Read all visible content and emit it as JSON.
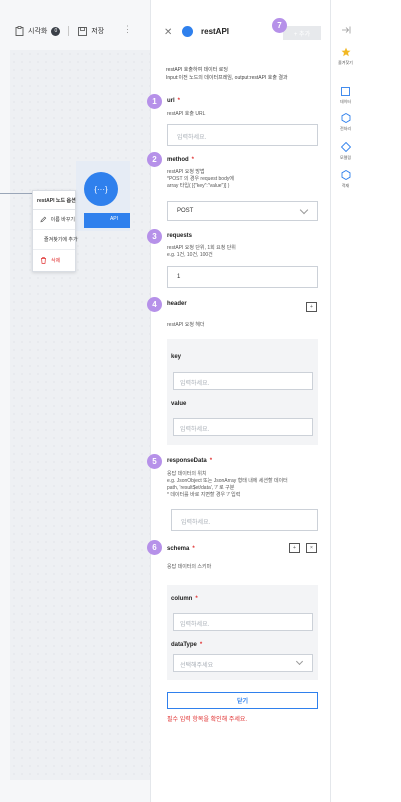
{
  "toolbar": {
    "visualize_label": "시각화",
    "visualize_badge": "0",
    "save_label": "저장",
    "more": "⋮"
  },
  "canvas": {
    "node_label": "API",
    "node_icon": "{···}",
    "context_menu": {
      "title": "restAPI 노드 옵션",
      "items": [
        {
          "label": "이름 바꾸기",
          "icon": "pencil-icon"
        },
        {
          "label": "즐겨찾기에 추가",
          "icon": "star-icon"
        },
        {
          "label": "삭제",
          "icon": "trash-icon"
        }
      ]
    }
  },
  "panel": {
    "title": "restAPI",
    "add_button": "+ 추가",
    "description": [
      "restAPI 호출하여 데이터 로딩",
      "Input:이전 노드의 데이터프레임, output:restAPI 호출 결과"
    ],
    "markers": [
      "1",
      "2",
      "3",
      "4",
      "5",
      "6",
      "7"
    ],
    "url": {
      "label": "url",
      "help": [
        "restAPI 호출 URL"
      ],
      "placeholder": "입력하세요."
    },
    "method": {
      "label": "method",
      "help": [
        "restAPI 요청 방법",
        "*POST 의 경우 request body에",
        "array 타입( [{\"key\":\"value\"}] )"
      ],
      "value": "POST"
    },
    "requests": {
      "label": "requests",
      "help": [
        "restAPI 요청 단위, 1회 요청 단위",
        "e.g. 1건, 10건, 100건"
      ],
      "value": "1"
    },
    "header": {
      "label": "header",
      "help": [
        "restAPI 요청 헤더"
      ],
      "add": "+",
      "key_label": "key",
      "key_placeholder": "입력하세요.",
      "value_label": "value",
      "value_placeholder": "입력하세요."
    },
    "response_data": {
      "label": "responseData",
      "help": [
        "응답 데이터의 위치",
        "e.g. JsonObject 또는 JsonArray 형태 내에 세션할 데이터",
        "path, 'result$et/data', '/' 로 구분",
        "* 데이터를 바로 지면할 경우 '/' 입력"
      ],
      "placeholder": "입력하세요."
    },
    "schema": {
      "label": "schema",
      "help": [
        "응답 데이터의 스키마"
      ],
      "btn_a": "+",
      "btn_b": "×",
      "column_label": "column",
      "column_placeholder": "입력하세요.",
      "datatype_label": "dataType",
      "datatype_placeholder": "선택해주세요"
    },
    "close_button": "닫기",
    "error_text": "필수 입력 항목을 확인해 주세요."
  },
  "rail": {
    "items": [
      {
        "label": "즐겨찾기",
        "icon": "star-icon"
      },
      {
        "label": "데이터",
        "icon": "square-icon"
      },
      {
        "label": "전처리",
        "icon": "hexagon-icon"
      },
      {
        "label": "모델링",
        "icon": "diamond-icon"
      },
      {
        "label": "적재",
        "icon": "hexagon-outline-icon"
      }
    ]
  },
  "colors": {
    "accent": "#2f80ed",
    "marker": "#b691e9",
    "danger": "#e03131"
  }
}
